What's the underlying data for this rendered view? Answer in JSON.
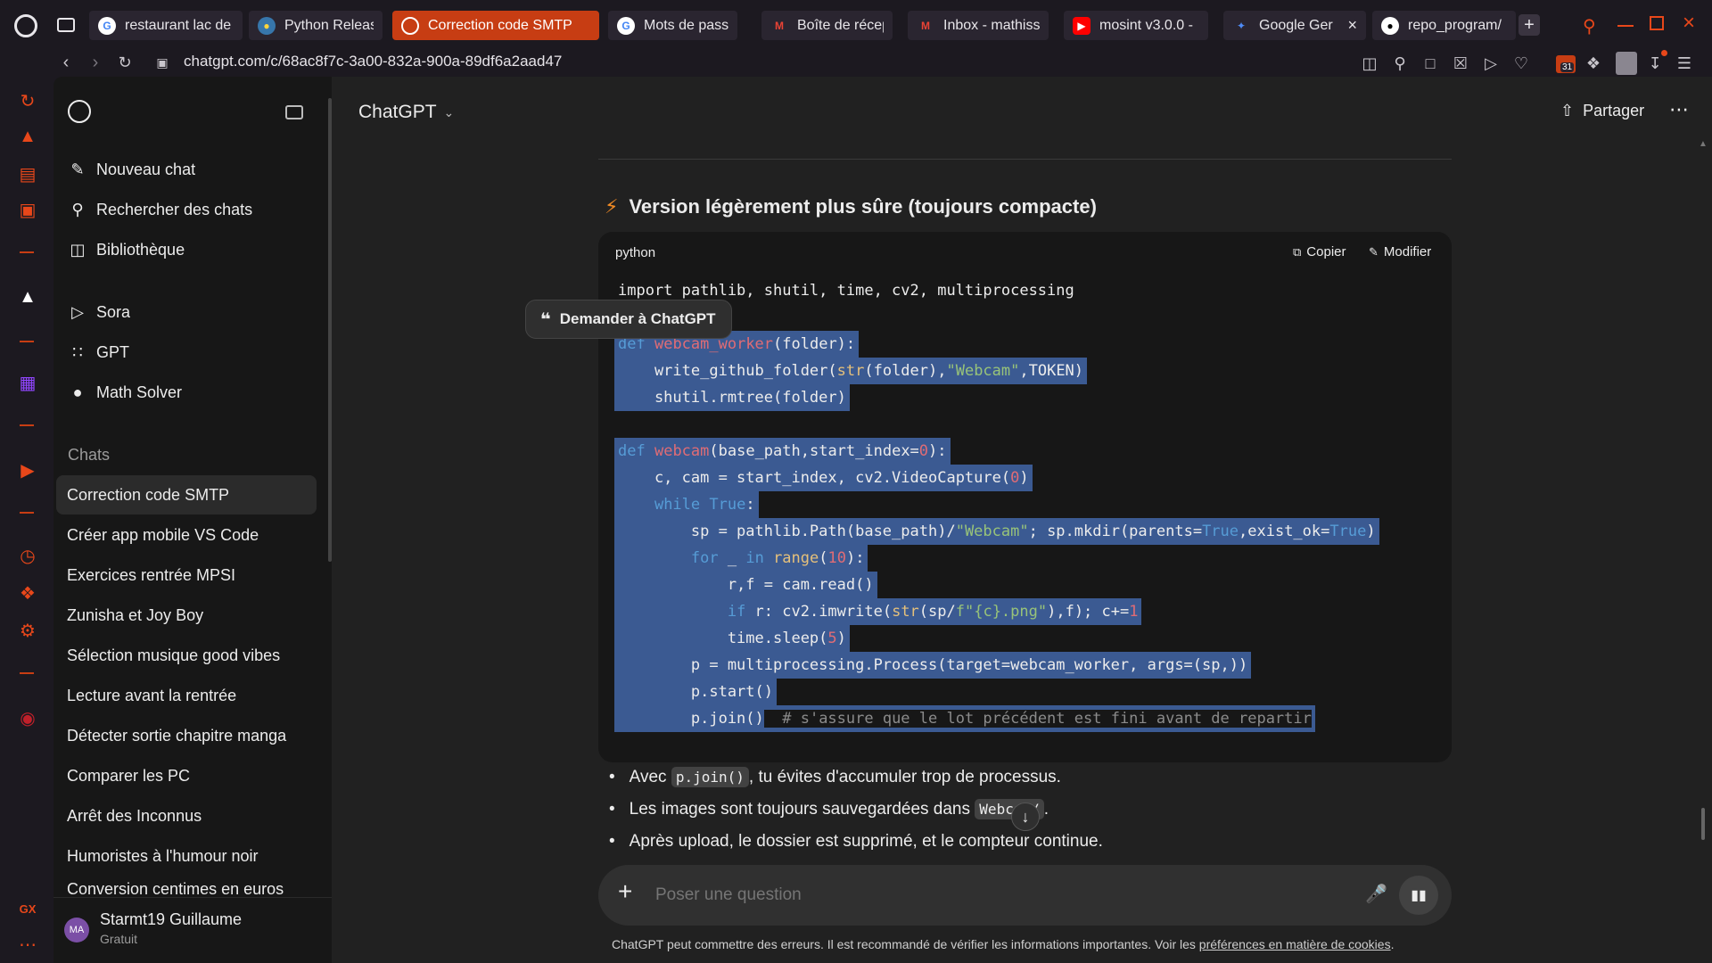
{
  "browser": {
    "tabs": [
      {
        "label": "restaurant lac de",
        "icon": "google-icon"
      },
      {
        "label": "Python Release",
        "icon": "python-icon"
      },
      {
        "label": "Correction code SMTP",
        "icon": "chatgpt-icon",
        "active": true
      },
      {
        "label": "Mots de passe",
        "icon": "google-icon"
      },
      {
        "label": "Boîte de récepti",
        "icon": "gmail-icon"
      },
      {
        "label": "Inbox - mathiss",
        "icon": "gmail-icon"
      },
      {
        "label": "mosint v3.0.0 -",
        "icon": "youtube-icon"
      },
      {
        "label": "Google Ger",
        "icon": "gemini-icon"
      },
      {
        "label": "repo_program/",
        "icon": "github-icon"
      }
    ],
    "url": "chatgpt.com/c/68ac8f7c-3a00-832a-900a-89df6a2aad47",
    "badge_count": "31",
    "accent": "#c73d13"
  },
  "sidebar": {
    "top": [
      {
        "label": "Nouveau chat",
        "icon": "edit-icon"
      },
      {
        "label": "Rechercher des chats",
        "icon": "search-icon"
      },
      {
        "label": "Bibliothèque",
        "icon": "library-icon"
      }
    ],
    "apps": [
      {
        "label": "Sora",
        "icon": "sora-icon"
      },
      {
        "label": "GPT",
        "icon": "gpt-grid-icon"
      },
      {
        "label": "Math Solver",
        "icon": "math-avatar-icon"
      }
    ],
    "section_title": "Chats",
    "chats": [
      "Correction code SMTP",
      "Créer app mobile VS Code",
      "Exercices rentrée MPSI",
      "Zunisha et Joy Boy",
      "Sélection musique good vibes",
      "Lecture avant la rentrée",
      "Détecter sortie chapitre manga",
      "Comparer les PC",
      "Arrêt des Inconnus",
      "Humoristes à l'humour noir",
      "Conversion centimes en euros"
    ],
    "user": {
      "initials": "MA",
      "name": "Starmt19 Guillaume",
      "plan": "Gratuit"
    }
  },
  "header": {
    "title": "ChatGPT",
    "share_label": "Partager"
  },
  "content": {
    "heading": "Version légèrement plus sûre (toujours compacte)",
    "code_lang": "python",
    "copy_label": "Copier",
    "edit_label": "Modifier",
    "ask_tooltip": "Demander à ChatGPT",
    "code_first_line": "import pathlib, shutil, time, cv2, multiprocessing",
    "bullets": [
      {
        "pre": "Avec ",
        "code": "p.join()",
        "post": ", tu évites d'accumuler trop de processus."
      },
      {
        "pre": "Les images sont toujours sauvegardées dans ",
        "code": "Webcam/",
        "post": "."
      },
      {
        "pre": "Après upload, le dossier est supprimé, et le compteur continue.",
        "code": "",
        "post": ""
      }
    ]
  },
  "composer": {
    "placeholder": "Poser une question",
    "disclaimer": "ChatGPT peut commettre des erreurs. Il est recommandé de vérifier les informations importantes. Voir les ",
    "disclaimer_link": "préférences en matière de cookies",
    "disclaimer_end": "."
  }
}
